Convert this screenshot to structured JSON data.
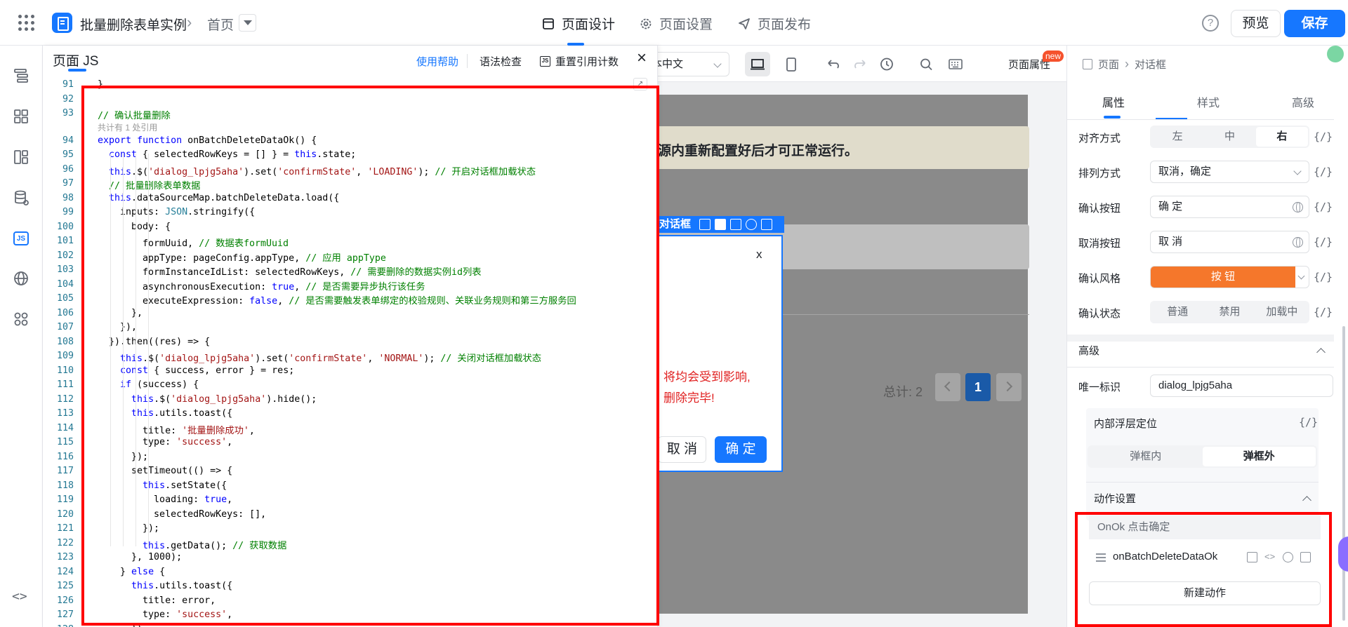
{
  "header": {
    "app_name": "批量删除表单实例",
    "page_name": "首页",
    "tabs": [
      {
        "label": "页面设计",
        "icon": "layout-icon"
      },
      {
        "label": "页面设置",
        "icon": "gear-icon"
      },
      {
        "label": "页面发布",
        "icon": "send-icon"
      }
    ],
    "help_icon": "?",
    "preview_label": "预览",
    "save_label": "保存",
    "accent": "#1677ff"
  },
  "left_rail": {
    "items": [
      "outline-icon",
      "components-icon",
      "page-icon",
      "datasource-icon",
      "js-icon",
      "globe-icon",
      "apps-icon",
      "code-icon"
    ],
    "js_label": "JS",
    "code_label": "<>"
  },
  "js_panel": {
    "title": "页面 JS",
    "help_link": "使用帮助",
    "lint_label": "语法检查",
    "reset_label": "重置引用计数",
    "reset_icon_label": "JS",
    "close_label": "×",
    "expand_label": "↗",
    "ref_hint": "共计有 1 处引用",
    "lines": [
      {
        "n": "91",
        "t": "}"
      },
      {
        "n": "92",
        "t": ""
      },
      {
        "n": "93",
        "t": "// 确认批量删除"
      },
      {
        "n": "94",
        "t": "export function onBatchDeleteDataOk() {"
      },
      {
        "n": "95",
        "t": "  const { selectedRowKeys = [] } = this.state;"
      },
      {
        "n": "96",
        "t": "  this.$('dialog_lpjg5aha').set('confirmState', 'LOADING'); // 开启对话框加载状态"
      },
      {
        "n": "97",
        "t": "  // 批量删除表单数据"
      },
      {
        "n": "98",
        "t": "  this.dataSourceMap.batchDeleteData.load({"
      },
      {
        "n": "99",
        "t": "    inputs: JSON.stringify({"
      },
      {
        "n": "100",
        "t": "      body: {"
      },
      {
        "n": "101",
        "t": "        formUuid, // 数据表formUuid"
      },
      {
        "n": "102",
        "t": "        appType: pageConfig.appType, // 应用 appType"
      },
      {
        "n": "103",
        "t": "        formInstanceIdList: selectedRowKeys, // 需要删除的数据实例id列表"
      },
      {
        "n": "104",
        "t": "        asynchronousExecution: true, // 是否需要异步执行该任务"
      },
      {
        "n": "105",
        "t": "        executeExpression: false, // 是否需要触发表单绑定的校验规则、关联业务规则和第三方服务回"
      },
      {
        "n": "106",
        "t": "      },"
      },
      {
        "n": "107",
        "t": "    }),"
      },
      {
        "n": "108",
        "t": "  }).then((res) => {"
      },
      {
        "n": "109",
        "t": "    this.$('dialog_lpjg5aha').set('confirmState', 'NORMAL'); // 关闭对话框加载状态"
      },
      {
        "n": "110",
        "t": "    const { success, error } = res;"
      },
      {
        "n": "111",
        "t": "    if (success) {"
      },
      {
        "n": "112",
        "t": "      this.$('dialog_lpjg5aha').hide();"
      },
      {
        "n": "113",
        "t": "      this.utils.toast({"
      },
      {
        "n": "114",
        "t": "        title: '批量删除成功',"
      },
      {
        "n": "115",
        "t": "        type: 'success',"
      },
      {
        "n": "116",
        "t": "      });"
      },
      {
        "n": "117",
        "t": "      setTimeout(() => {"
      },
      {
        "n": "118",
        "t": "        this.setState({"
      },
      {
        "n": "119",
        "t": "          loading: true,"
      },
      {
        "n": "120",
        "t": "          selectedRowKeys: [],"
      },
      {
        "n": "121",
        "t": "        });"
      },
      {
        "n": "122",
        "t": "        this.getData(); // 获取数据"
      },
      {
        "n": "123",
        "t": "      }, 1000);"
      },
      {
        "n": "124",
        "t": "    } else {"
      },
      {
        "n": "125",
        "t": "      this.utils.toast({"
      },
      {
        "n": "126",
        "t": "        title: error,"
      },
      {
        "n": "127",
        "t": "        type: 'success',"
      },
      {
        "n": "128",
        "t": "      });"
      }
    ]
  },
  "canvas": {
    "language": "本中文",
    "page_props": "页面属性",
    "new_badge": "new",
    "warning_text": "源内重新配置好后才可正常运行。",
    "total_label": "总计: 2",
    "current_page": "1",
    "dialog": {
      "tag": "对话框",
      "close": "x",
      "red_line1": "将均会受到影响,",
      "red_line2": "删除完毕!",
      "cancel": "取 消",
      "ok": "确 定"
    }
  },
  "right_panel": {
    "breadcrumb": [
      "页面",
      "对话框"
    ],
    "tabs": [
      "属性",
      "样式",
      "高级"
    ],
    "align_label": "对齐方式",
    "align_options": [
      "左",
      "中",
      "右"
    ],
    "align_selected": "右",
    "order_label": "排列方式",
    "order_value": "取消，确定",
    "ok_label": "确认按钮",
    "ok_value": "确 定",
    "cancel_label": "取消按钮",
    "cancel_value": "取 消",
    "ok_style_label": "确认风格",
    "ok_style_value": "按 钮",
    "ok_state_label": "确认状态",
    "ok_state_options": [
      "普通",
      "禁用",
      "加载中"
    ],
    "fx": "{/}",
    "advanced_title": "高级",
    "uid_label": "唯一标识",
    "uid_value": "dialog_lpjg5aha",
    "layer_label": "内部浮层定位",
    "layer_options": [
      "弹框内",
      "弹框外"
    ],
    "layer_selected": "弹框外",
    "action_title": "动作设置",
    "action_event": "OnOk 点击确定",
    "action_name": "onBatchDeleteDataOk",
    "new_action": "新建动作",
    "orange": "#f5772b"
  }
}
